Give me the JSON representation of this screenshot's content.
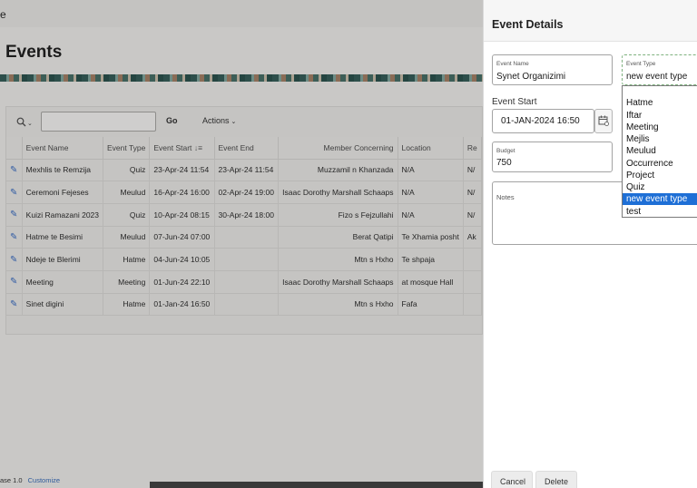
{
  "app": {
    "title_fragment": "e"
  },
  "page": {
    "title": "Events"
  },
  "toolbar": {
    "go_label": "Go",
    "actions_label": "Actions"
  },
  "table": {
    "columns": [
      "Event Name",
      "Event Type",
      "Event Start",
      "Event End",
      "Member Concerning",
      "Location",
      "Re"
    ],
    "rows": [
      [
        "Mexhlis te Remzija",
        "Quiz",
        "23-Apr-24 11:54",
        "23-Apr-24 11:54",
        "Muzzamil n Khanzada",
        "N/A",
        "N/"
      ],
      [
        "Ceremoni Fejeses",
        "Meulud",
        "16-Apr-24 16:00",
        "02-Apr-24 19:00",
        "Isaac Dorothy Marshall Schaaps",
        "N/A",
        "N/"
      ],
      [
        "Kuizi Ramazani 2023",
        "Quiz",
        "10-Apr-24 08:15",
        "30-Apr-24 18:00",
        "Fizo s Fejzullahi",
        "N/A",
        "N/"
      ],
      [
        "Hatme te Besimi",
        "Meulud",
        "07-Jun-24 07:00",
        "",
        "Berat Qatipi",
        "Te Xhamia posht",
        "Ak"
      ],
      [
        "Ndeje te Blerimi",
        "Hatme",
        "04-Jun-24 10:05",
        "",
        "Mtn s Hxho",
        "Te shpaja",
        ""
      ],
      [
        "Meeting",
        "Meeting",
        "01-Jun-24 22:10",
        "",
        "Isaac Dorothy Marshall Schaaps",
        "at mosque Hall",
        ""
      ],
      [
        "Sinet digini",
        "Hatme",
        "01-Jan-24 16:50",
        "",
        "Mtn s Hxho",
        "Fafa",
        ""
      ]
    ]
  },
  "footer": {
    "version_fragment": "ase 1.0",
    "customize_label": "Customize"
  },
  "dialog": {
    "title": "Event Details",
    "event_name": {
      "label": "Event Name",
      "value": "Synet Organizimi"
    },
    "event_type": {
      "label": "Event Type",
      "value": "new event type",
      "options": [
        "Hatme",
        "Iftar",
        "Meeting",
        "Mejlis",
        "Meulud",
        "Occurrence",
        "Project",
        "Quiz",
        "new event type",
        "test"
      ],
      "selected_index": 8
    },
    "event_start": {
      "label": "Event Start",
      "value": "01-JAN-2024 16:50"
    },
    "budget": {
      "label": "Budget",
      "value": "750"
    },
    "notes": {
      "label": "Notes",
      "value": ""
    },
    "cancel_label": "Cancel",
    "delete_label": "Delete"
  },
  "icons": {
    "search": "search-icon",
    "chevron": "chevron-down-icon",
    "sort": "sort-desc-icon",
    "edit": "edit-icon",
    "calendar": "calendar-icon"
  },
  "colors": {
    "selection": "#1e6fd6",
    "link": "#2e5a9b",
    "edit_icon": "#2f5aa3"
  }
}
